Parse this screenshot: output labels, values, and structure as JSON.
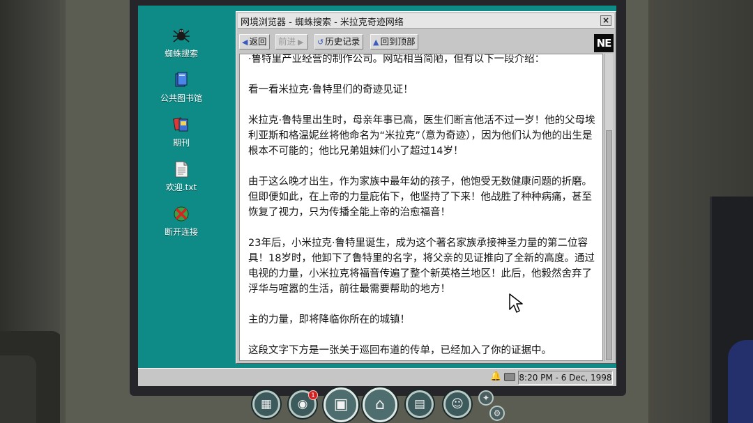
{
  "desktop": {
    "icons": [
      {
        "label": "蜘蛛搜索",
        "icon": "spider-icon"
      },
      {
        "label": "公共图书馆",
        "icon": "books-icon"
      },
      {
        "label": "期刊",
        "icon": "magazine-icon"
      },
      {
        "label": "欢迎.txt",
        "icon": "text-file-icon"
      },
      {
        "label": "断开连接",
        "icon": "disconnect-icon"
      }
    ]
  },
  "browser": {
    "title": "网境浏览器 - 蜘蛛搜索 - 米拉克奇迹网络",
    "close_label": "×",
    "toolbar": {
      "back": "返回",
      "forward": "前进",
      "history": "历史记录",
      "top": "回到顶部",
      "logo": "NE"
    },
    "paragraphs": [
      "·鲁特里产业经营的制作公司。网站相当简陋，但有以下一段介绍：",
      "看一看米拉克·鲁特里们的奇迹见证！",
      "米拉克·鲁特里出生时，母亲年事已高，医生们断言他活不过一岁！他的父母埃利亚斯和格温妮丝将他命名为“米拉克”（意为奇迹），因为他们认为他的出生是根本不可能的；他比兄弟姐妹们小了超过14岁！",
      "由于这么晚才出生，作为家族中最年幼的孩子，他饱受无数健康问题的折磨。但即便如此，在上帝的力量庇佑下，他坚持了下来！他战胜了种种病痛，甚至恢复了视力，只为传播全能上帝的治愈福音！",
      "23年后，小米拉克·鲁特里诞生，成为这个著名家族承接神圣力量的第二位容具！18岁时，他卸下了鲁特里的名字，将父亲的见证推向了全新的高度。通过电视的力量，小米拉克将福音传遍了整个新英格兰地区！此后，他毅然舍弃了浮华与喧嚣的生活，前往最需要帮助的地方！",
      "主的力量，即将降临你所在的城镇！",
      "这段文字下方是一张关于巡回布道的传单，已经加入了你的证据中。"
    ]
  },
  "taskbar": {
    "clock": "8:20 PM - 6 Dec, 1998"
  },
  "dock": {
    "items": [
      {
        "name": "evidence-board",
        "glyph": "▦"
      },
      {
        "name": "suspects",
        "glyph": "◉"
      },
      {
        "name": "computer",
        "glyph": "▣"
      },
      {
        "name": "home",
        "glyph": "⌂"
      },
      {
        "name": "journal",
        "glyph": "▤"
      },
      {
        "name": "chat",
        "glyph": "☺"
      }
    ],
    "badge_count": "1",
    "settings_glyph": "⚙"
  },
  "colors": {
    "desktop": "#0e8b86",
    "window": "#c6c6c6",
    "accent": "#3b5bbd"
  }
}
